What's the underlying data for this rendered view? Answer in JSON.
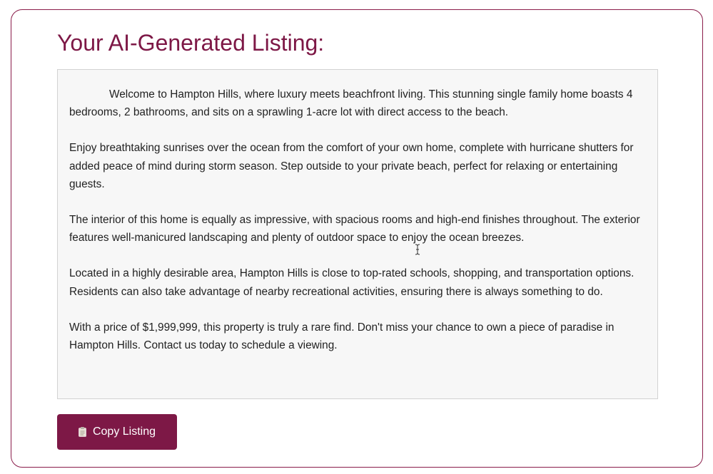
{
  "page": {
    "title": "Your AI-Generated Listing:",
    "accent_color": "#7d1846"
  },
  "listing": {
    "paragraphs": [
      "Welcome to Hampton Hills, where luxury meets beachfront living. This stunning single family home boasts 4 bedrooms, 2 bathrooms, and sits on a sprawling 1-acre lot with direct access to the beach.",
      "Enjoy breathtaking sunrises over the ocean from the comfort of your own home, complete with hurricane shutters for added peace of mind during storm season. Step outside to your private beach, perfect for relaxing or entertaining guests.",
      "The interior of this home is equally as impressive, with spacious rooms and high-end finishes throughout. The exterior features well-manicured landscaping and plenty of outdoor space to enjoy the ocean breezes.",
      "Located in a highly desirable area, Hampton Hills is close to top-rated schools, shopping, and transportation options. Residents can also take advantage of nearby recreational activities, ensuring there is always something to do.",
      "With a price of $1,999,999, this property is truly a rare find. Don't miss your chance to own a piece of paradise in Hampton Hills. Contact us today to schedule a viewing."
    ]
  },
  "actions": {
    "copy_label": "Copy Listing",
    "copy_icon": "clipboard-icon"
  },
  "cursor": {
    "type": "text-cursor-icon"
  }
}
